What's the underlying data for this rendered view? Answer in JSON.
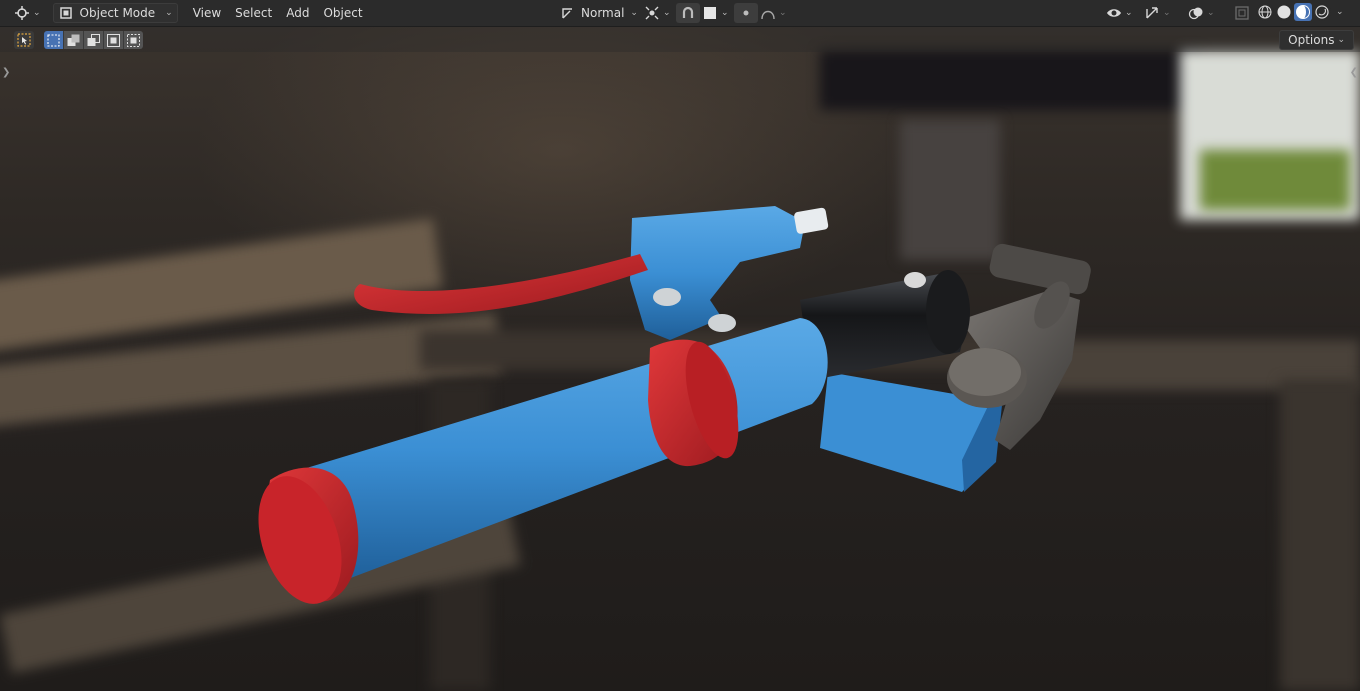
{
  "header": {
    "editor_type_icon": "cursor-3d-icon",
    "mode_label": "Object Mode",
    "menus": [
      "View",
      "Select",
      "Add",
      "Object"
    ],
    "orientation_label": "Normal",
    "shading_modes": [
      "wireframe",
      "solid",
      "material-preview",
      "rendered"
    ],
    "active_shading": "material-preview"
  },
  "tool_header": {
    "options_label": "Options"
  },
  "colors": {
    "header_bg": "#2b2b2b",
    "accent_blue": "#4772b3",
    "model_blue": "#3b8fd4",
    "model_red": "#c8242a"
  }
}
